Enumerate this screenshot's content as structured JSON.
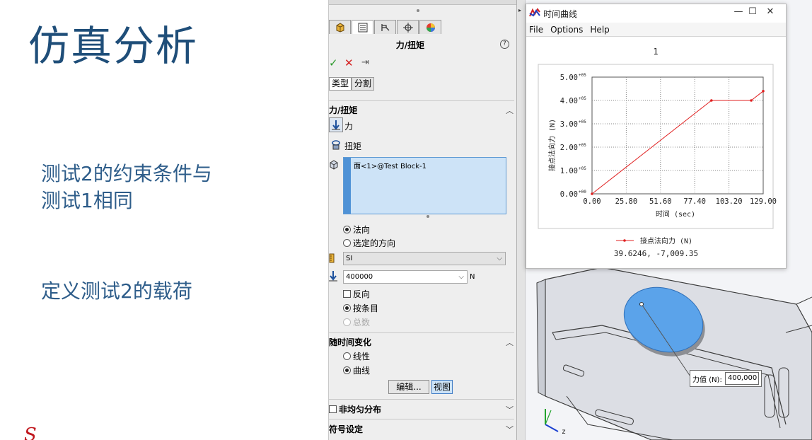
{
  "slide": {
    "title": "仿真分析",
    "line1": "测试2的约束条件与",
    "line2": "测试1相同",
    "line3": "定义测试2的载荷",
    "logo": "S"
  },
  "property_manager": {
    "title": "力/扭矩",
    "help": "?",
    "tabs": [
      "type",
      "split"
    ],
    "tab_type": "类型",
    "tab_split": "分割",
    "group_force_torque": "力/扭矩",
    "force_label": "力",
    "torque_label": "扭矩",
    "selection_item": "面<1>@Test Block-1",
    "normal": "法向",
    "selected_direction": "选定的方向",
    "unit_system": "SI",
    "force_value": "400000",
    "force_unit": "N",
    "reverse": "反向",
    "per_item": "按条目",
    "total": "总数",
    "group_time_variation": "随时间变化",
    "linear": "线性",
    "curve": "曲线",
    "edit_button": "编辑...",
    "view_button": "视图",
    "group_nonuniform": "非均匀分布",
    "group_symbol": "符号设定",
    "colors": {
      "accent": "#4f92d6",
      "selection": "#cde3f7"
    }
  },
  "time_curve_window": {
    "title": "时间曲线",
    "menu": [
      "File",
      "Options",
      "Help"
    ],
    "readout": "39.6246, -7,009.35"
  },
  "chart_data": {
    "type": "line",
    "title": "1",
    "xlabel": "时间 (sec)",
    "ylabel": "接点法向力 (N)",
    "xlim": [
      0,
      129
    ],
    "ylim": [
      0,
      500000
    ],
    "x_ticks": [
      "0.00",
      "25.80",
      "51.60",
      "77.40",
      "103.20",
      "129.00"
    ],
    "y_ticks": [
      "0.00",
      "1.00",
      "2.00",
      "3.00",
      "4.00",
      "5.00"
    ],
    "y_tick_exponent": [
      "+00",
      "+05",
      "+05",
      "+05",
      "+05",
      "+05"
    ],
    "grid": true,
    "legend": "bottom",
    "series": [
      {
        "name": "接点法向力 (N)",
        "color": "#e02020",
        "x": [
          0,
          90,
          120,
          129
        ],
        "y": [
          0,
          400000,
          400000,
          440000
        ]
      }
    ]
  },
  "viewport": {
    "callout_label": "力值 (N):",
    "callout_value": "400,000",
    "axis_z": "z",
    "colors": {
      "face": "#5ba3ea",
      "body": "#d9dbe2"
    }
  }
}
